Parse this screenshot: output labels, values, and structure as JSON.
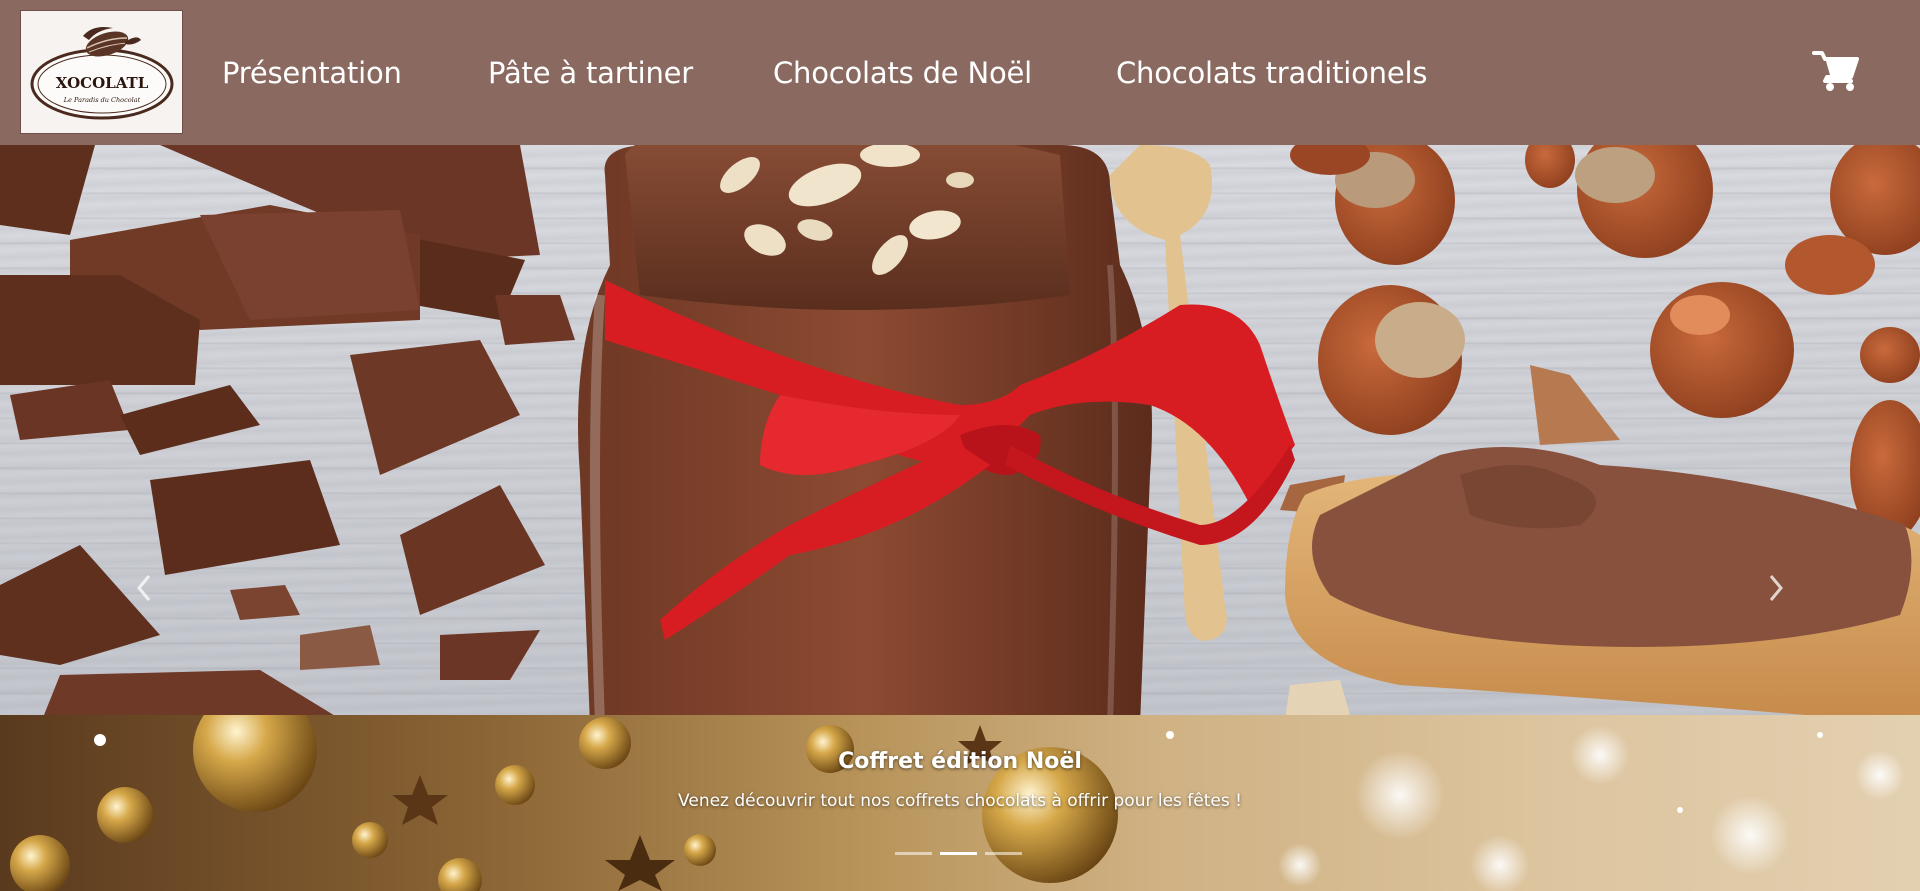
{
  "brand": {
    "name": "XOCOLATL",
    "tagline": "Le Paradis du Chocolat"
  },
  "nav": {
    "items": [
      {
        "label": "Présentation"
      },
      {
        "label": "Pâte à tartiner"
      },
      {
        "label": "Chocolats de Noël"
      },
      {
        "label": "Chocolats traditionels"
      }
    ],
    "cart_icon": "shopping-cart-icon"
  },
  "carousel": {
    "prev_icon": "chevron-left-icon",
    "next_icon": "chevron-right-icon",
    "caption": {
      "title": "Coffret édition Noël",
      "text": "Venez découvrir tout nos coffrets chocolats à offrir pour les fêtes !"
    },
    "slide_count": 3,
    "active_index": 1
  },
  "colors": {
    "header_bg": "#8a6a60",
    "accent_red": "#d81d22",
    "chocolate": "#6b3a26"
  }
}
